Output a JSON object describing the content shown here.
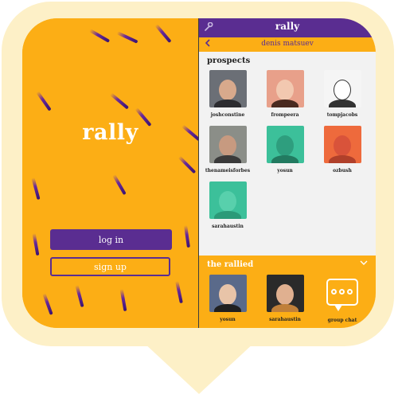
{
  "splash": {
    "logo": "rally",
    "login_label": "log in",
    "signup_label": "sign up"
  },
  "app": {
    "title": "rally",
    "settings_icon": "wrench-icon",
    "back_icon": "chevron-left-icon",
    "subtitle": "denis matsuev",
    "prospects_title": "prospects",
    "prospects": [
      {
        "name": "joshconstine"
      },
      {
        "name": "frompeera"
      },
      {
        "name": "tompjacobs"
      },
      {
        "name": "thenameisforbes"
      },
      {
        "name": "yosun"
      },
      {
        "name": "ozbush"
      },
      {
        "name": "sarahaustin"
      }
    ],
    "rallied_title": "the rallied",
    "collapse_icon": "chevron-down-icon",
    "rallied": [
      {
        "name": "yosun"
      },
      {
        "name": "sarahaustin"
      },
      {
        "name": "group chat"
      }
    ]
  },
  "colors": {
    "orange": "#fcae15",
    "purple": "#5a2d91",
    "bubble": "#fdf0c7"
  }
}
